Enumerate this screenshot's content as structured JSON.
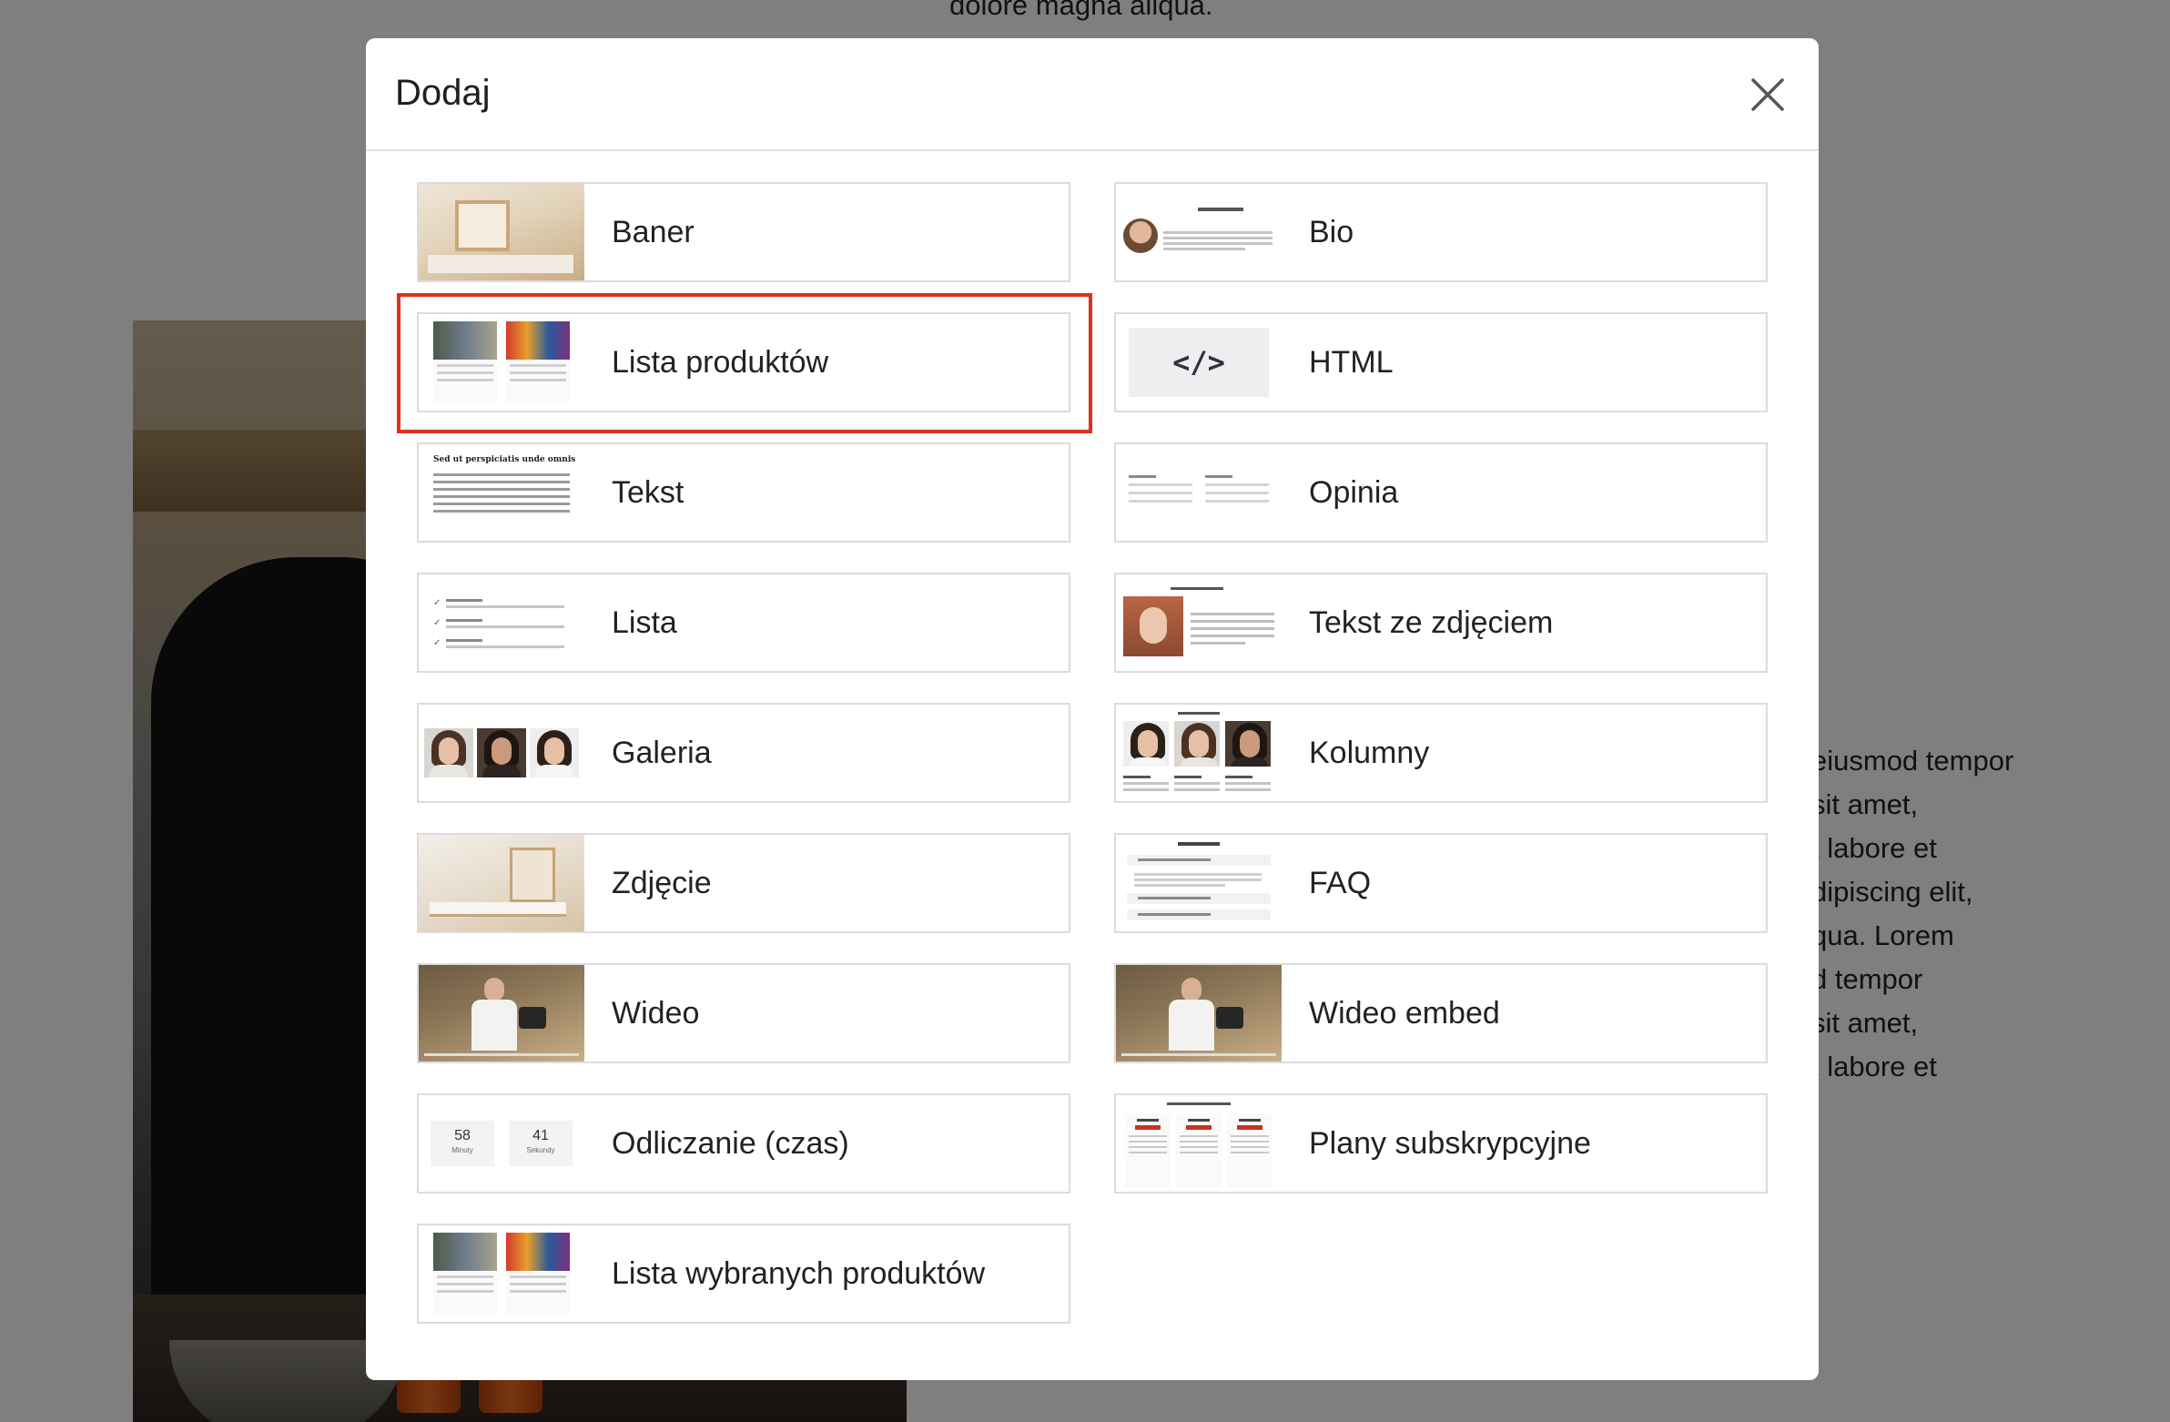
{
  "background": {
    "top_text": "dolore magna aliqua.",
    "right_text_lines": [
      "eiusmod tempor",
      "sit amet,",
      "t labore et",
      "dipiscing elit,",
      "qua. Lorem",
      "d tempor",
      "sit amet,",
      "t labore et"
    ]
  },
  "modal": {
    "title": "Dodaj",
    "close_icon": "close-icon",
    "items": [
      {
        "id": "baner",
        "label": "Baner",
        "column": "left"
      },
      {
        "id": "lista-produktow",
        "label": "Lista produktów",
        "column": "left",
        "highlighted": true
      },
      {
        "id": "tekst",
        "label": "Tekst",
        "column": "left"
      },
      {
        "id": "lista",
        "label": "Lista",
        "column": "left"
      },
      {
        "id": "galeria",
        "label": "Galeria",
        "column": "left"
      },
      {
        "id": "zdjecie",
        "label": "Zdjęcie",
        "column": "left"
      },
      {
        "id": "wideo",
        "label": "Wideo",
        "column": "left"
      },
      {
        "id": "odliczanie",
        "label": "Odliczanie (czas)",
        "column": "left"
      },
      {
        "id": "lista-wybranych",
        "label": "Lista wybranych produktów",
        "column": "left"
      },
      {
        "id": "bio",
        "label": "Bio",
        "column": "right"
      },
      {
        "id": "html",
        "label": "HTML",
        "column": "right"
      },
      {
        "id": "opinia",
        "label": "Opinia",
        "column": "right"
      },
      {
        "id": "tekst-ze-zdjeciem",
        "label": "Tekst ze zdjęciem",
        "column": "right"
      },
      {
        "id": "kolumny",
        "label": "Kolumny",
        "column": "right"
      },
      {
        "id": "faq",
        "label": "FAQ",
        "column": "right"
      },
      {
        "id": "wideo-embed",
        "label": "Wideo embed",
        "column": "right"
      },
      {
        "id": "plany",
        "label": "Plany subskrypcyjne",
        "column": "right"
      }
    ],
    "thumb_text": {
      "tekst_heading": "Sed ut perspiciatis unde omnis",
      "countdown_a_value": "58",
      "countdown_a_unit": "Minuty",
      "countdown_b_value": "41",
      "countdown_b_unit": "Sekundy",
      "html_code_glyph": "</>"
    },
    "highlight_color": "#d9321f"
  }
}
